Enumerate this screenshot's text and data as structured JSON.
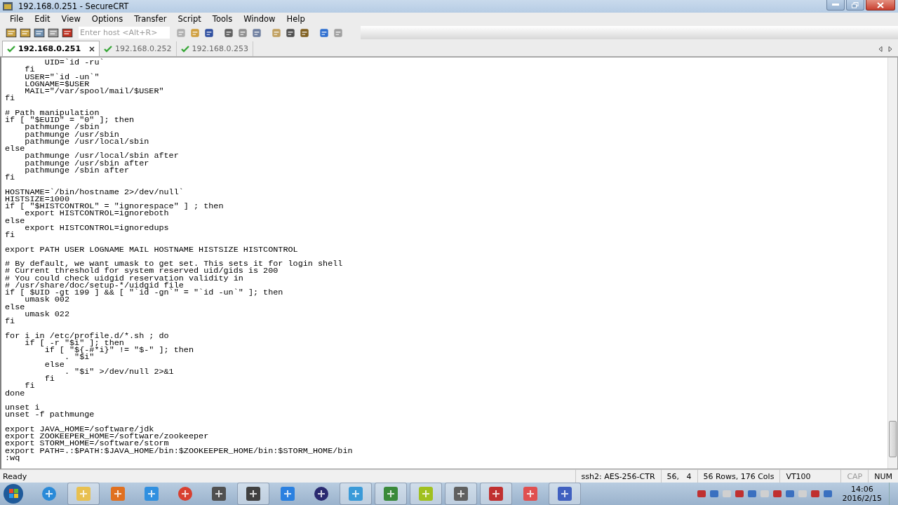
{
  "window": {
    "title": "192.168.0.251 - SecureCRT"
  },
  "menu": [
    "File",
    "Edit",
    "View",
    "Options",
    "Transfer",
    "Script",
    "Tools",
    "Window",
    "Help"
  ],
  "toolbar": {
    "host_field": {
      "placeholder": "Enter host <Alt+R>"
    }
  },
  "tabs": [
    {
      "label": "192.168.0.251",
      "selected": true,
      "connected": true
    },
    {
      "label": "192.168.0.252",
      "selected": false,
      "connected": true
    },
    {
      "label": "192.168.0.253",
      "selected": false,
      "connected": true
    }
  ],
  "terminal": {
    "lines": [
      {
        "kind": "code",
        "text": "        UID=`id -ru`"
      },
      {
        "kind": "code",
        "text": "    fi"
      },
      {
        "kind": "code",
        "text": "    USER=\"`id -un`\""
      },
      {
        "kind": "code",
        "text": "    LOGNAME=$USER"
      },
      {
        "kind": "code",
        "text": "    MAIL=\"/var/spool/mail/$USER\""
      },
      {
        "kind": "code",
        "text": "fi"
      },
      {
        "kind": "blank"
      },
      {
        "kind": "code",
        "text": "# Path manipulation"
      },
      {
        "kind": "code",
        "text": "if [ \"$EUID\" = \"0\" ]; then"
      },
      {
        "kind": "code",
        "text": "    pathmunge /sbin"
      },
      {
        "kind": "code",
        "text": "    pathmunge /usr/sbin"
      },
      {
        "kind": "code",
        "text": "    pathmunge /usr/local/sbin"
      },
      {
        "kind": "code",
        "text": "else"
      },
      {
        "kind": "code",
        "text": "    pathmunge /usr/local/sbin after"
      },
      {
        "kind": "code",
        "text": "    pathmunge /usr/sbin after"
      },
      {
        "kind": "code",
        "text": "    pathmunge /sbin after"
      },
      {
        "kind": "code",
        "text": "fi"
      },
      {
        "kind": "blank"
      },
      {
        "kind": "code",
        "text": "HOSTNAME=`/bin/hostname 2>/dev/null`"
      },
      {
        "kind": "code",
        "text": "HISTSIZE=1000"
      },
      {
        "kind": "code",
        "text": "if [ \"$HISTCONTROL\" = \"ignorespace\" ] ; then"
      },
      {
        "kind": "code",
        "text": "    export HISTCONTROL=ignoreboth"
      },
      {
        "kind": "code",
        "text": "else"
      },
      {
        "kind": "code",
        "text": "    export HISTCONTROL=ignoredups"
      },
      {
        "kind": "code",
        "text": "fi"
      },
      {
        "kind": "blank"
      },
      {
        "kind": "code",
        "text": "export PATH USER LOGNAME MAIL HOSTNAME HISTSIZE HISTCONTROL"
      },
      {
        "kind": "blank"
      },
      {
        "kind": "code",
        "text": "# By default, we want umask to get set. This sets it for login shell"
      },
      {
        "kind": "code",
        "text": "# Current threshold for system reserved uid/gids is 200"
      },
      {
        "kind": "code",
        "text": "# You could check uidgid reservation validity in"
      },
      {
        "kind": "code",
        "text": "# /usr/share/doc/setup-*/uidgid file"
      },
      {
        "kind": "code",
        "text": "if [ $UID -gt 199 ] && [ \"`id -gn`\" = \"`id -un`\" ]; then"
      },
      {
        "kind": "code",
        "text": "    umask 002"
      },
      {
        "kind": "code",
        "text": "else"
      },
      {
        "kind": "code",
        "text": "    umask 022"
      },
      {
        "kind": "code",
        "text": "fi"
      },
      {
        "kind": "blank"
      },
      {
        "kind": "code",
        "text": "for i in /etc/profile.d/*.sh ; do"
      },
      {
        "kind": "code",
        "text": "    if [ -r \"$i\" ]; then"
      },
      {
        "kind": "code",
        "text": "        if [ \"${-#*i}\" != \"$-\" ]; then"
      },
      {
        "kind": "code",
        "text": "            . \"$i\""
      },
      {
        "kind": "code",
        "text": "        else"
      },
      {
        "kind": "code",
        "text": "            . \"$i\" >/dev/null 2>&1"
      },
      {
        "kind": "code",
        "text": "        fi"
      },
      {
        "kind": "code",
        "text": "    fi"
      },
      {
        "kind": "code",
        "text": "done"
      },
      {
        "kind": "blank"
      },
      {
        "kind": "code",
        "text": "unset i"
      },
      {
        "kind": "code",
        "text": "unset -f pathmunge"
      },
      {
        "kind": "blank"
      },
      {
        "kind": "code",
        "text": "export JAVA_HOME=/software/jdk"
      },
      {
        "kind": "code",
        "text": "export ZOOKEEPER_HOME=/software/zookeeper"
      },
      {
        "kind": "code",
        "text": "export STORM_HOME=/software/storm"
      },
      {
        "kind": "code",
        "text": "export PATH=.:$PATH:$JAVA_HOME/bin:$ZOOKEEPER_HOME/bin:$STORM_HOME/bin"
      },
      {
        "kind": "code",
        "text": ":wq"
      }
    ]
  },
  "status_bar": {
    "message": "Ready",
    "cipher": "ssh2: AES-256-CTR",
    "cursor": "56,   4",
    "size": "56 Rows, 176 Cols",
    "emulation": "VT100",
    "indicators": [
      {
        "label": "CAP",
        "on": false
      },
      {
        "label": "NUM",
        "on": true
      }
    ]
  },
  "taskbar": {
    "clock": {
      "time": "14:06",
      "date": "2016/2/15"
    }
  }
}
